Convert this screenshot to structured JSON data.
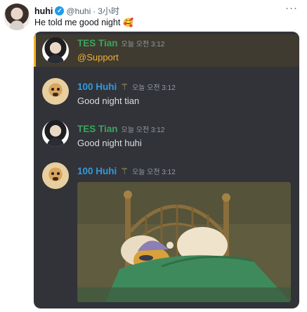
{
  "tweet": {
    "name": "huhi",
    "handle": "@huhi",
    "separator": "·",
    "time": "3小时",
    "text": "He told me good night",
    "emoji": "🥰",
    "verified_mark": "✓"
  },
  "discord": {
    "messages": [
      {
        "user": "TES Tian",
        "timestamp": "오늘 오전 3:12",
        "mention": "@Support",
        "color": "#3ba55d"
      },
      {
        "user": "100 Huhi",
        "timestamp": "오늘 오전 3:12",
        "text": "Good night tian",
        "color": "#3498db",
        "badge_icon": "caduceus-icon"
      },
      {
        "user": "TES Tian",
        "timestamp": "오늘 오전 3:12",
        "text": "Good night huhi",
        "color": "#3ba55d"
      },
      {
        "user": "100 Huhi",
        "timestamp": "오늘 오전 3:12",
        "color": "#3498db",
        "badge_icon": "caduceus-icon",
        "attachment": "sleeping-bear-gif"
      }
    ]
  },
  "colors": {
    "card_bg": "#313338",
    "mention_highlight": "#f0b132",
    "twitter_blue": "#1d9bf0"
  }
}
